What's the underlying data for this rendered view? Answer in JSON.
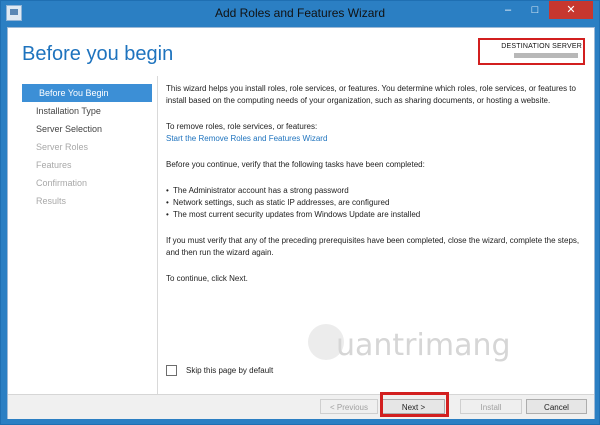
{
  "window": {
    "title": "Add Roles and Features Wizard",
    "controls": [
      "‒",
      "□",
      "✕"
    ]
  },
  "header": {
    "page_title": "Before you begin",
    "destination_label": "DESTINATION SERVER"
  },
  "sidebar": {
    "items": [
      {
        "label": "Before You Begin",
        "state": "active"
      },
      {
        "label": "Installation Type",
        "state": "enabled"
      },
      {
        "label": "Server Selection",
        "state": "enabled"
      },
      {
        "label": "Server Roles",
        "state": "disabled"
      },
      {
        "label": "Features",
        "state": "disabled"
      },
      {
        "label": "Confirmation",
        "state": "disabled"
      },
      {
        "label": "Results",
        "state": "disabled"
      }
    ]
  },
  "content": {
    "intro": "This wizard helps you install roles, role services, or features. You determine which roles, role services, or features to install based on the computing needs of your organization, such as sharing documents, or hosting a website.",
    "remove_text": "To remove roles, role services, or features:",
    "remove_link": "Start the Remove Roles and Features Wizard",
    "verify_text": "Before you continue, verify that the following tasks have been completed:",
    "bullets": [
      "The Administrator account has a strong password",
      "Network settings, such as static IP addresses, are configured",
      "The most current security updates from Windows Update are installed"
    ],
    "prereq_text": "If you must verify that any of the preceding prerequisites have been completed, close the wizard, complete the steps, and then run the wizard again.",
    "continue_text": "To continue, click Next."
  },
  "skip": {
    "label": "Skip this page by default",
    "checked": false
  },
  "watermark": {
    "text": "uantrimang"
  },
  "footer": {
    "previous": "< Previous",
    "next": "Next >",
    "install": "Install",
    "cancel": "Cancel"
  },
  "colors": {
    "frame": "#2b7fc3",
    "accent": "#1e73be",
    "active_nav": "#3c8fd6",
    "highlight": "#d21f1f"
  }
}
